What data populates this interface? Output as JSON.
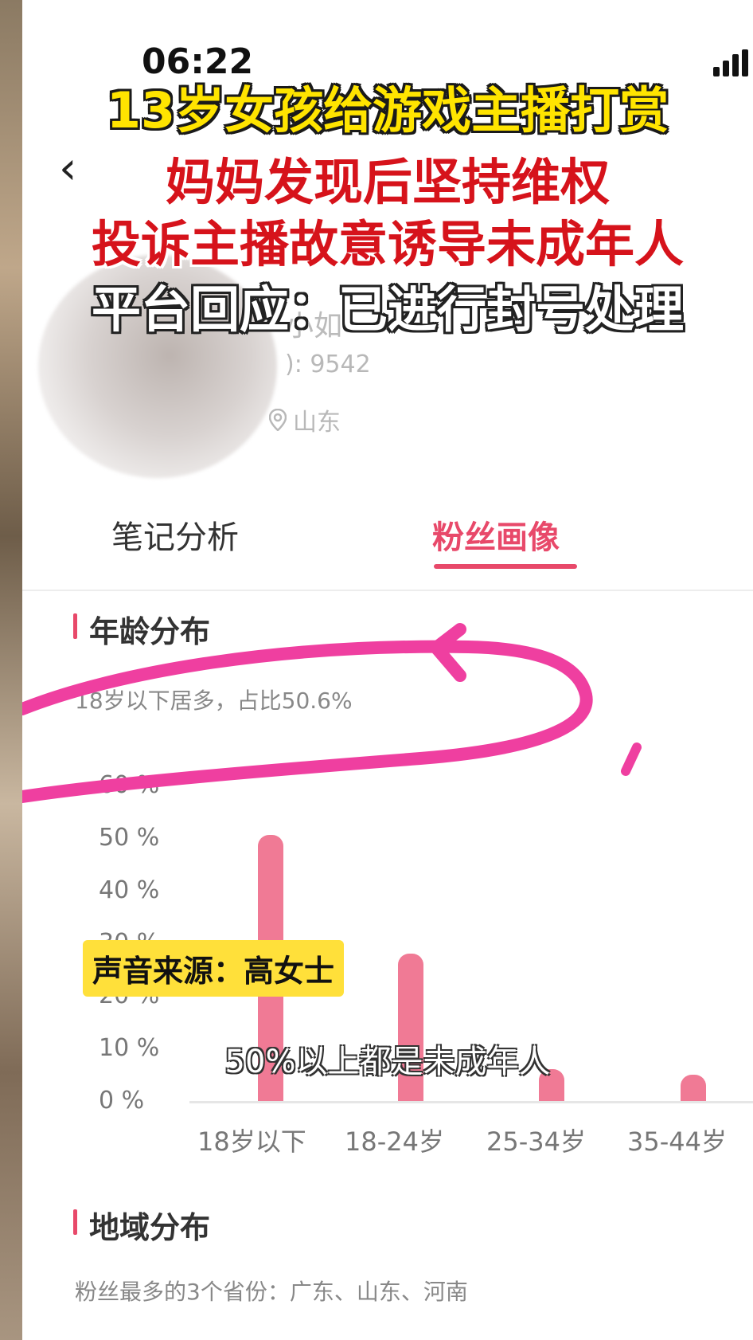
{
  "status_bar": {
    "time": "06:22"
  },
  "headline": {
    "line1": "13岁女孩给游戏主播打赏",
    "line2": "妈妈发现后坚持维权",
    "line3": "投诉主播故意诱导未成年人",
    "line4": "平台回应：已进行封号处理"
  },
  "profile": {
    "name_partial": "小如",
    "id_partial": "): 9542",
    "location_partial": "山东"
  },
  "tabs": [
    {
      "label": "笔记分析",
      "active": false
    },
    {
      "label": "粉丝画像",
      "active": true
    }
  ],
  "age_section": {
    "title": "年龄分布",
    "description": "18岁以下居多，占比50.6%"
  },
  "region_section": {
    "title": "地域分布",
    "description": "粉丝最多的3个省份：广东、山东、河南"
  },
  "overlay": {
    "voice_source": "声音来源：高女士",
    "subtitle": "50%以上都是未成年人"
  },
  "colors": {
    "accent": "#e8496a",
    "bar": "#ef6f8c",
    "headline_yellow": "#ffe400",
    "headline_red": "#d6131b",
    "annotation_magenta": "#ef3fa0"
  },
  "chart_data": {
    "type": "bar",
    "title": "年龄分布",
    "categories": [
      "18岁以下",
      "18-24岁",
      "25-34岁",
      "35-44岁"
    ],
    "values": [
      50.6,
      28,
      6,
      5
    ],
    "y_ticks": [
      "0 %",
      "10 %",
      "20 %",
      "30 %",
      "40 %",
      "50 %",
      "60 %"
    ],
    "ylim": [
      0,
      60
    ],
    "grid": false
  }
}
